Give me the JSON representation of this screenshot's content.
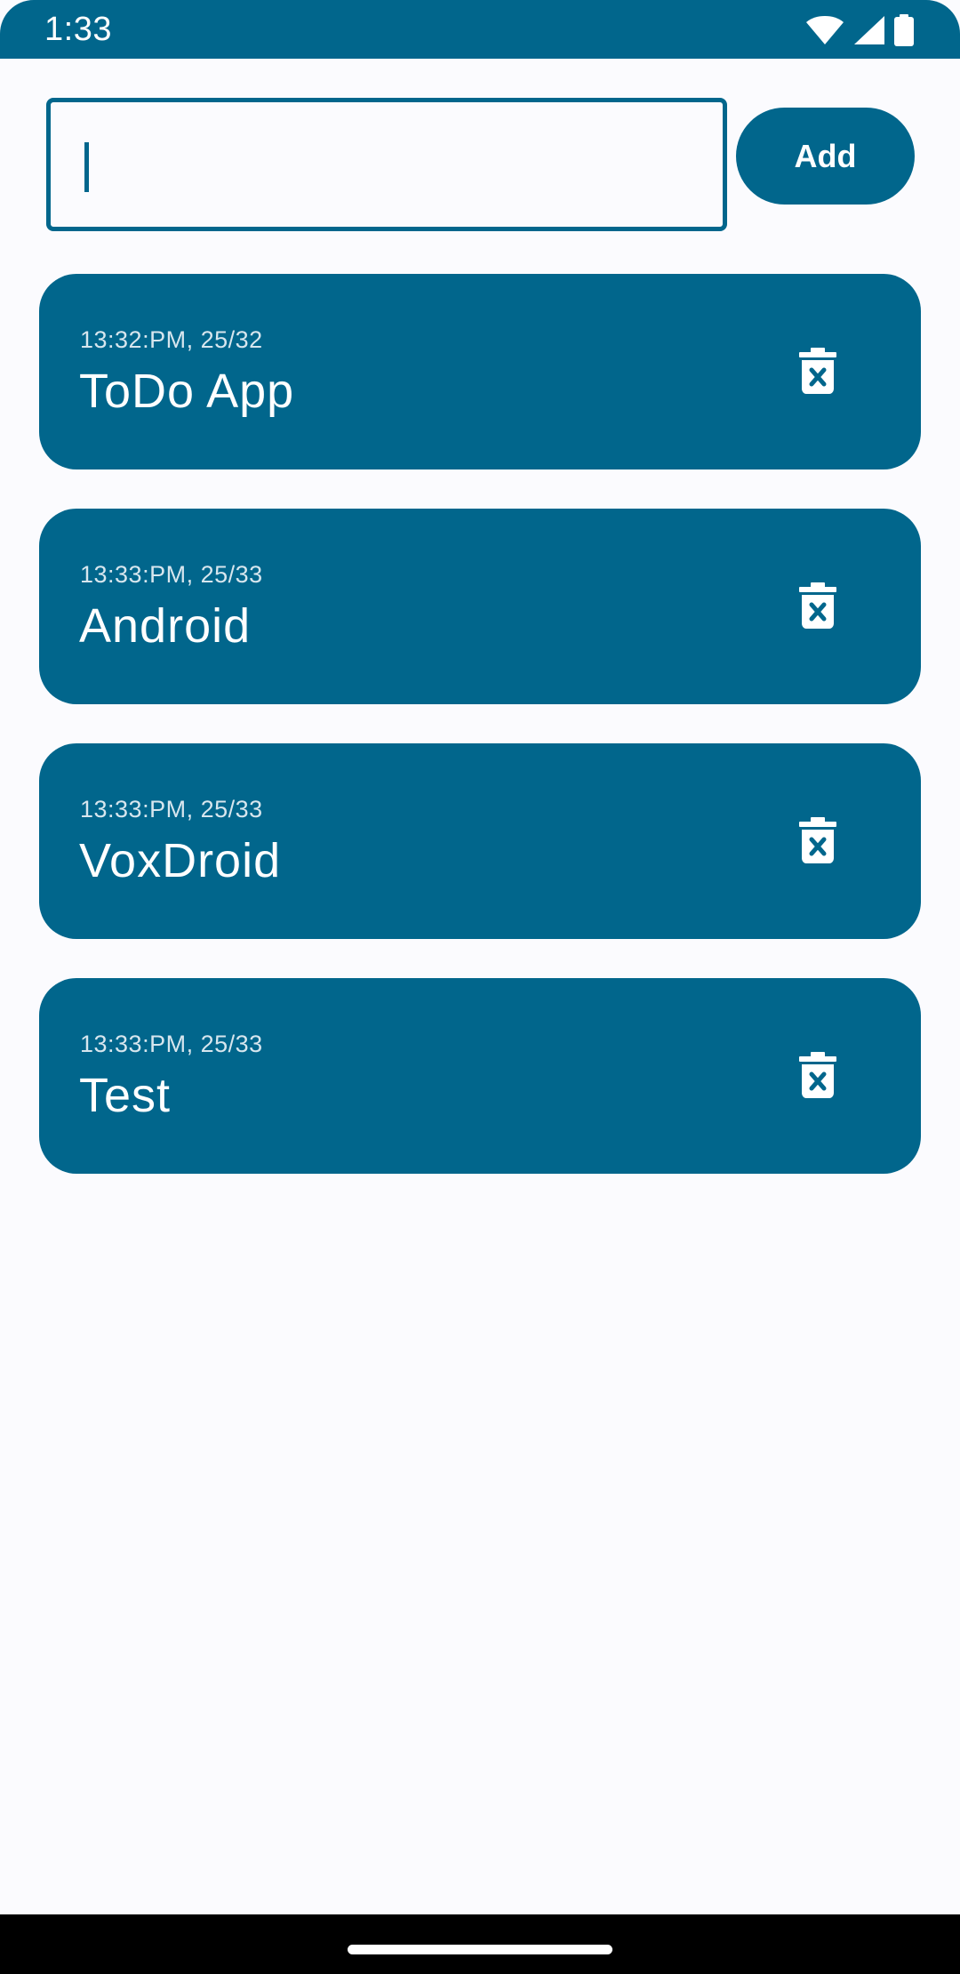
{
  "status_bar": {
    "time": "1:33",
    "icons": [
      "wifi-icon",
      "cellular-signal-icon",
      "battery-icon"
    ]
  },
  "input": {
    "value": "",
    "placeholder": ""
  },
  "add_button": {
    "label": "Add"
  },
  "todos": [
    {
      "time": "13:32:PM, 25/32",
      "title": "ToDo App",
      "delete_icon": "delete-icon"
    },
    {
      "time": "13:33:PM, 25/33",
      "title": "Android",
      "delete_icon": "delete-icon"
    },
    {
      "time": "13:33:PM, 25/33",
      "title": "VoxDroid",
      "delete_icon": "delete-icon"
    },
    {
      "time": "13:33:PM, 25/33",
      "title": "Test",
      "delete_icon": "delete-icon"
    }
  ],
  "colors": {
    "primary": "#01668C",
    "background": "#FBFBFE",
    "on_primary": "#FFFFFF",
    "timestamp": "#D7E6EE",
    "nav_bar": "#000000"
  }
}
